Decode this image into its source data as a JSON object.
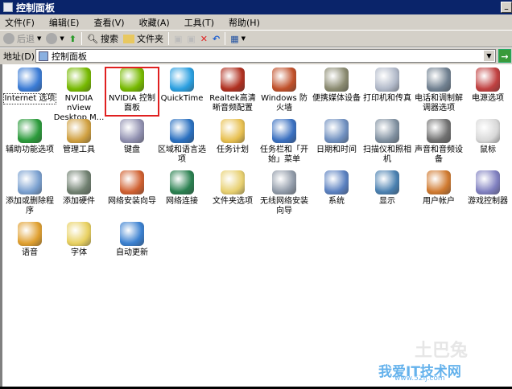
{
  "window": {
    "title": "控制面板"
  },
  "menu": [
    "文件(F)",
    "编辑(E)",
    "查看(V)",
    "收藏(A)",
    "工具(T)",
    "帮助(H)"
  ],
  "toolbar": {
    "back": "后退",
    "search": "搜索",
    "folders": "文件夹"
  },
  "address": {
    "label": "地址(D)",
    "value": "控制面板"
  },
  "items": [
    {
      "label": "Internet 选项",
      "icon": "internet-options-icon",
      "color": "#3a7bd5"
    },
    {
      "label": "NVIDIA nView Desktop M...",
      "icon": "nvidia-nview-icon",
      "color": "#76b900"
    },
    {
      "label": "NVIDIA 控制面板",
      "icon": "nvidia-control-panel-icon",
      "color": "#76b900"
    },
    {
      "label": "QuickTime",
      "icon": "quicktime-icon",
      "color": "#2a9fe0"
    },
    {
      "label": "Realtek高清晰音频配置",
      "icon": "realtek-audio-icon",
      "color": "#b03020"
    },
    {
      "label": "Windows 防火墙",
      "icon": "firewall-icon",
      "color": "#c0502a"
    },
    {
      "label": "便携媒体设备",
      "icon": "portable-media-icon",
      "color": "#8a8a70"
    },
    {
      "label": "打印机和传真",
      "icon": "printer-icon",
      "color": "#b0b8c8"
    },
    {
      "label": "电话和调制解调器选项",
      "icon": "phone-modem-icon",
      "color": "#708090"
    },
    {
      "label": "电源选项",
      "icon": "power-options-icon",
      "color": "#c04040"
    },
    {
      "label": "辅助功能选项",
      "icon": "accessibility-icon",
      "color": "#2a9a3a"
    },
    {
      "label": "管理工具",
      "icon": "admin-tools-icon",
      "color": "#d0a040"
    },
    {
      "label": "键盘",
      "icon": "keyboard-icon",
      "color": "#9090b0"
    },
    {
      "label": "区域和语言选项",
      "icon": "regional-language-icon",
      "color": "#2a70c0"
    },
    {
      "label": "任务计划",
      "icon": "scheduled-tasks-icon",
      "color": "#e8c050"
    },
    {
      "label": "任务栏和「开始」菜单",
      "icon": "taskbar-start-icon",
      "color": "#3a70c0"
    },
    {
      "label": "日期和时间",
      "icon": "date-time-icon",
      "color": "#7090c0"
    },
    {
      "label": "扫描仪和照相机",
      "icon": "scanner-camera-icon",
      "color": "#8090a0"
    },
    {
      "label": "声音和音频设备",
      "icon": "sound-icon",
      "color": "#707070"
    },
    {
      "label": "鼠标",
      "icon": "mouse-icon",
      "color": "#d8d8d8"
    },
    {
      "label": "添加或删除程序",
      "icon": "add-remove-programs-icon",
      "color": "#7aa0d0"
    },
    {
      "label": "添加硬件",
      "icon": "add-hardware-icon",
      "color": "#708070"
    },
    {
      "label": "网络安装向导",
      "icon": "network-setup-icon",
      "color": "#d06030"
    },
    {
      "label": "网络连接",
      "icon": "network-connections-icon",
      "color": "#2a8050"
    },
    {
      "label": "文件夹选项",
      "icon": "folder-options-icon",
      "color": "#e8d070"
    },
    {
      "label": "无线网络安装向导",
      "icon": "wireless-setup-icon",
      "color": "#909aa8"
    },
    {
      "label": "系统",
      "icon": "system-icon",
      "color": "#5a80c0"
    },
    {
      "label": "显示",
      "icon": "display-icon",
      "color": "#4a80b0"
    },
    {
      "label": "用户帐户",
      "icon": "user-accounts-icon",
      "color": "#d07a30"
    },
    {
      "label": "游戏控制器",
      "icon": "game-controller-icon",
      "color": "#8080c0"
    },
    {
      "label": "语音",
      "icon": "speech-icon",
      "color": "#e0a030"
    },
    {
      "label": "字体",
      "icon": "fonts-icon",
      "color": "#e8d060"
    },
    {
      "label": "自动更新",
      "icon": "automatic-updates-icon",
      "color": "#3a80d0"
    }
  ],
  "watermark": {
    "line1": "我爱IT技术网",
    "line2": "www.52ij.com",
    "line3": "土巴兔"
  }
}
